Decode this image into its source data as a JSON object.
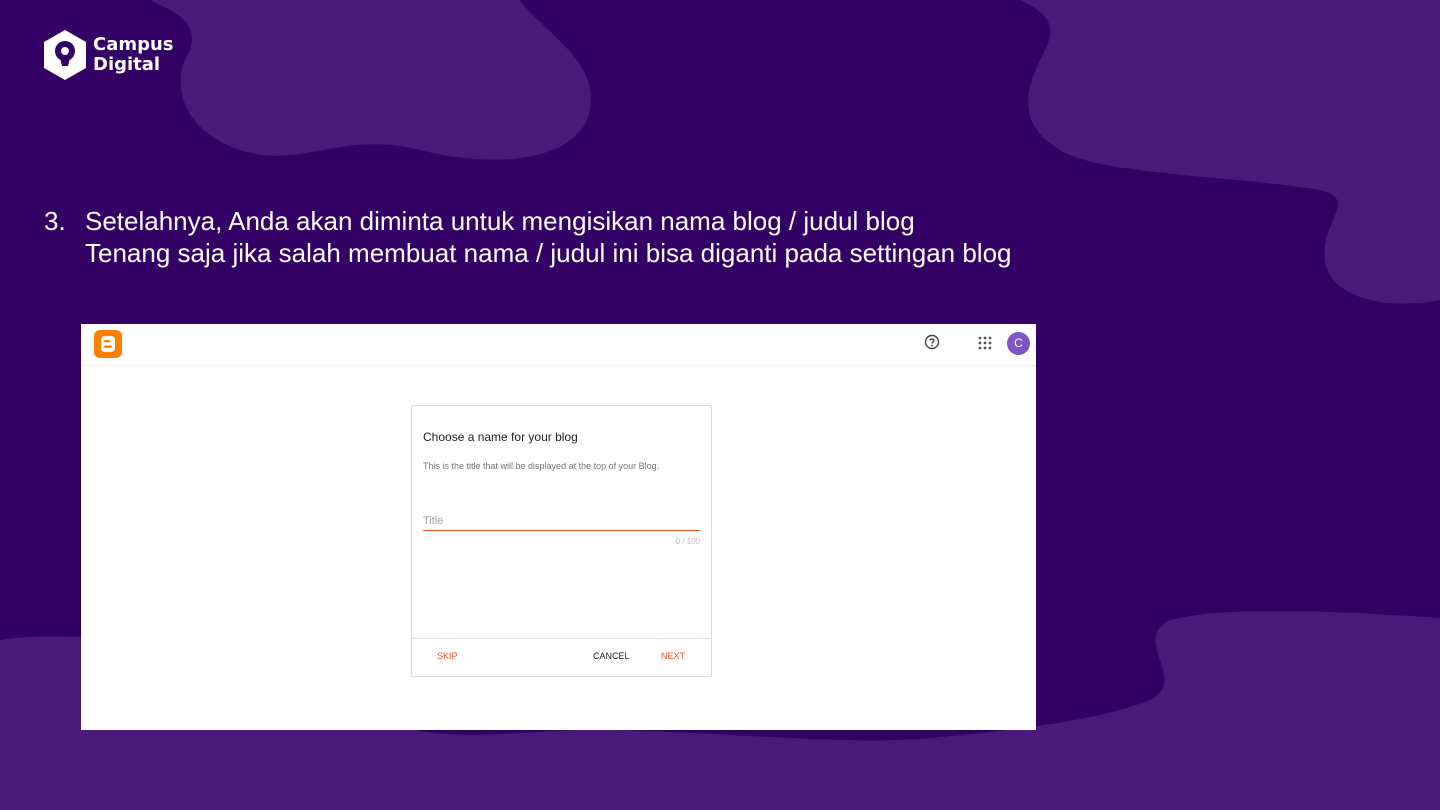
{
  "brand": {
    "line1": "Campus",
    "line2": "Digital"
  },
  "instruction": {
    "number": "3.",
    "line1": "Setelahnya, Anda akan diminta untuk mengisikan nama blog / judul blog",
    "line2": "Tenang saja jika salah membuat nama / judul ini bisa diganti pada settingan blog"
  },
  "colors": {
    "background": "#330066",
    "blob": "#4a1a7a",
    "accent": "#f4511e",
    "blogger": "#ff8000",
    "avatar": "#7e57c2"
  },
  "topbar": {
    "logo_icon": "blogger-icon",
    "help_icon": "help-circle-icon",
    "apps_icon": "apps-grid-icon",
    "avatar_letter": "C"
  },
  "dialog": {
    "title": "Choose a name for your blog",
    "description": "This is the title that will be displayed at the top of your Blog.",
    "input": {
      "placeholder": "Title",
      "value": ""
    },
    "counter": "0 / 100",
    "buttons": {
      "skip": "SKIP",
      "cancel": "CANCEL",
      "next": "NEXT"
    }
  }
}
